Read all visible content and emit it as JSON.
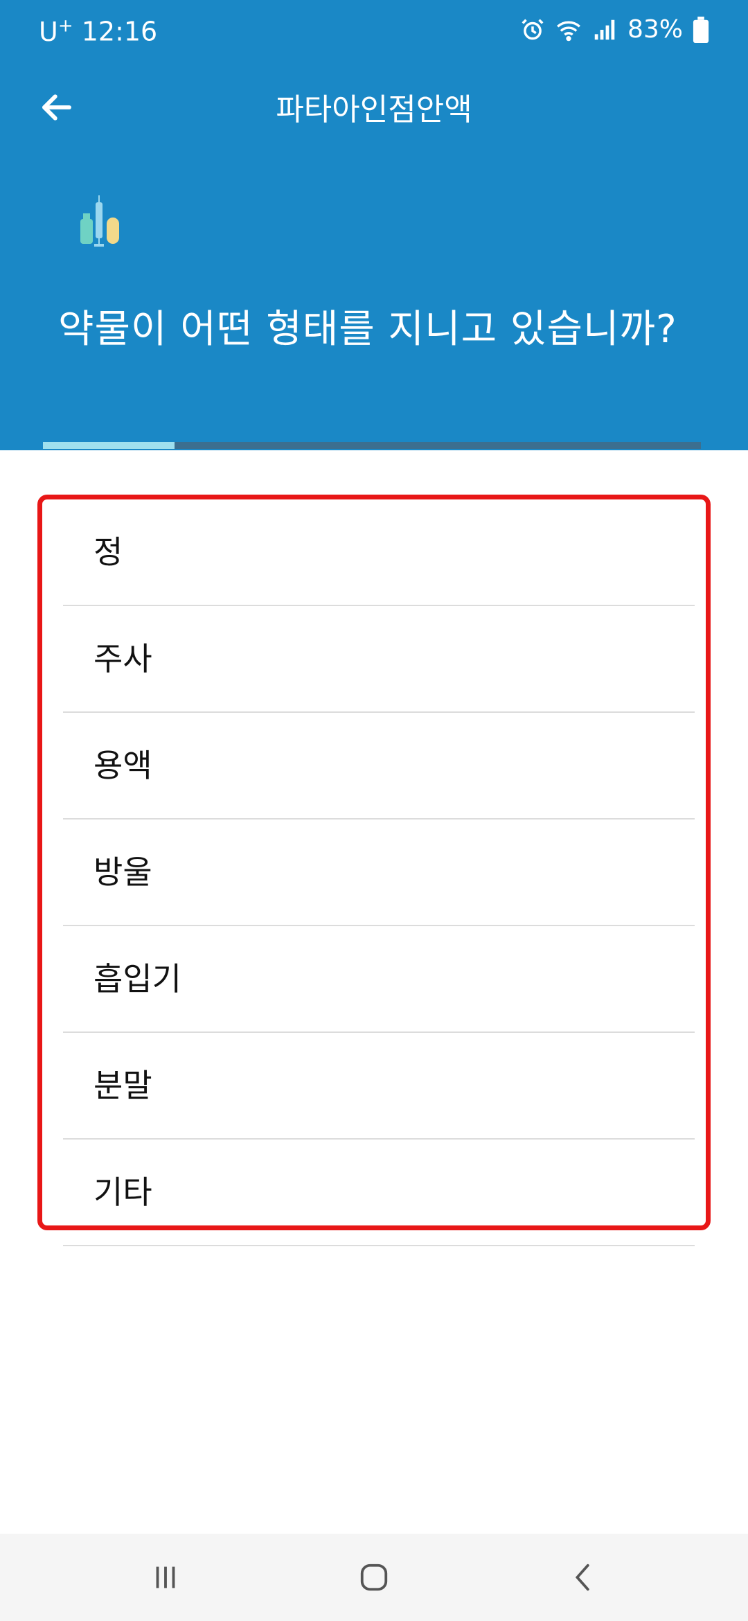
{
  "status_bar": {
    "carrier": "U",
    "carrier_sup": "+",
    "time": "12:16",
    "battery": "83%",
    "icons": [
      "alarm-icon",
      "wifi-icon",
      "signal-icon",
      "battery-icon"
    ]
  },
  "toolbar": {
    "title": "파타아인점안액",
    "back_icon": "arrow-left-icon"
  },
  "header": {
    "illustration_icon": "medicine-bottles-icon",
    "question": "약물이 어떤 형태를 지니고 있습니까?",
    "progress": 0.2
  },
  "options": [
    {
      "label": "정"
    },
    {
      "label": "주사"
    },
    {
      "label": "용액"
    },
    {
      "label": "방울"
    },
    {
      "label": "흡입기"
    },
    {
      "label": "분말"
    },
    {
      "label": "기타"
    }
  ],
  "nav_bar": {
    "icons": [
      "recent-apps-icon",
      "home-icon",
      "back-icon"
    ]
  },
  "colors": {
    "header": "#1a88c6",
    "progress_fill": "#9fe0ee",
    "highlight_border": "#e81717"
  }
}
